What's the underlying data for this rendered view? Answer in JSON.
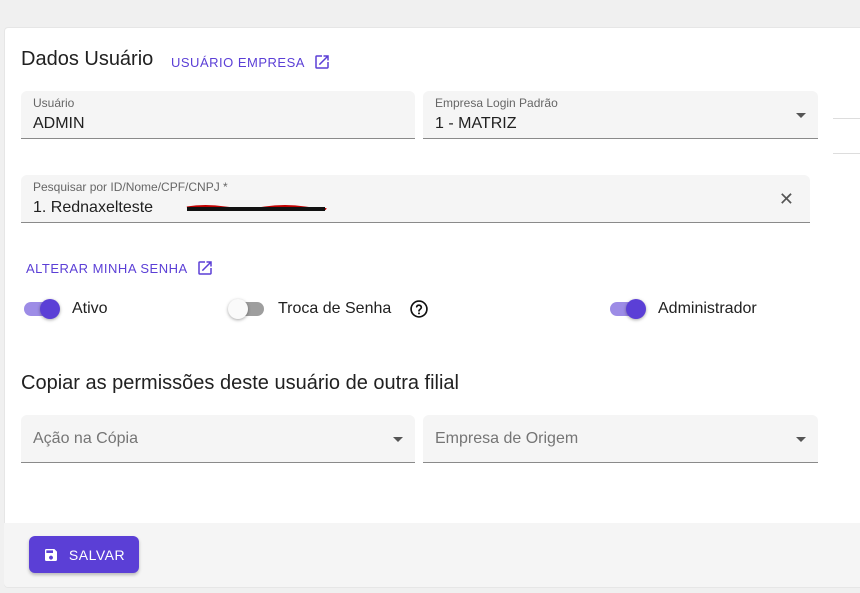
{
  "header": {
    "title": "Dados Usuário",
    "empresa_link": "USUÁRIO EMPRESA"
  },
  "fields": {
    "usuario": {
      "label": "Usuário",
      "value": "ADMIN"
    },
    "empresa_login": {
      "label": "Empresa Login Padrão",
      "value": "1 - MATRIZ"
    },
    "pesquisar": {
      "label": "Pesquisar por ID/Nome/CPF/CNPJ *",
      "value": "1. Rednaxelteste"
    }
  },
  "alterar_senha_link": "ALTERAR MINHA SENHA",
  "toggles": {
    "ativo": {
      "label": "Ativo",
      "on": true
    },
    "troca_senha": {
      "label": "Troca de Senha",
      "on": false
    },
    "administrador": {
      "label": "Administrador",
      "on": true
    }
  },
  "copy_section": {
    "title": "Copiar as permissões deste usuário de outra filial",
    "acao_placeholder": "Ação na Cópia",
    "empresa_origem_placeholder": "Empresa de Origem"
  },
  "footer": {
    "save_label": "SALVAR"
  },
  "icons": {
    "external": "open-in-new-icon",
    "save": "floppy-disk-icon",
    "help": "help-circle-icon",
    "clear": "close-icon"
  },
  "colors": {
    "accent": "#5b3fd6",
    "accent_light": "#9d8ce6"
  }
}
